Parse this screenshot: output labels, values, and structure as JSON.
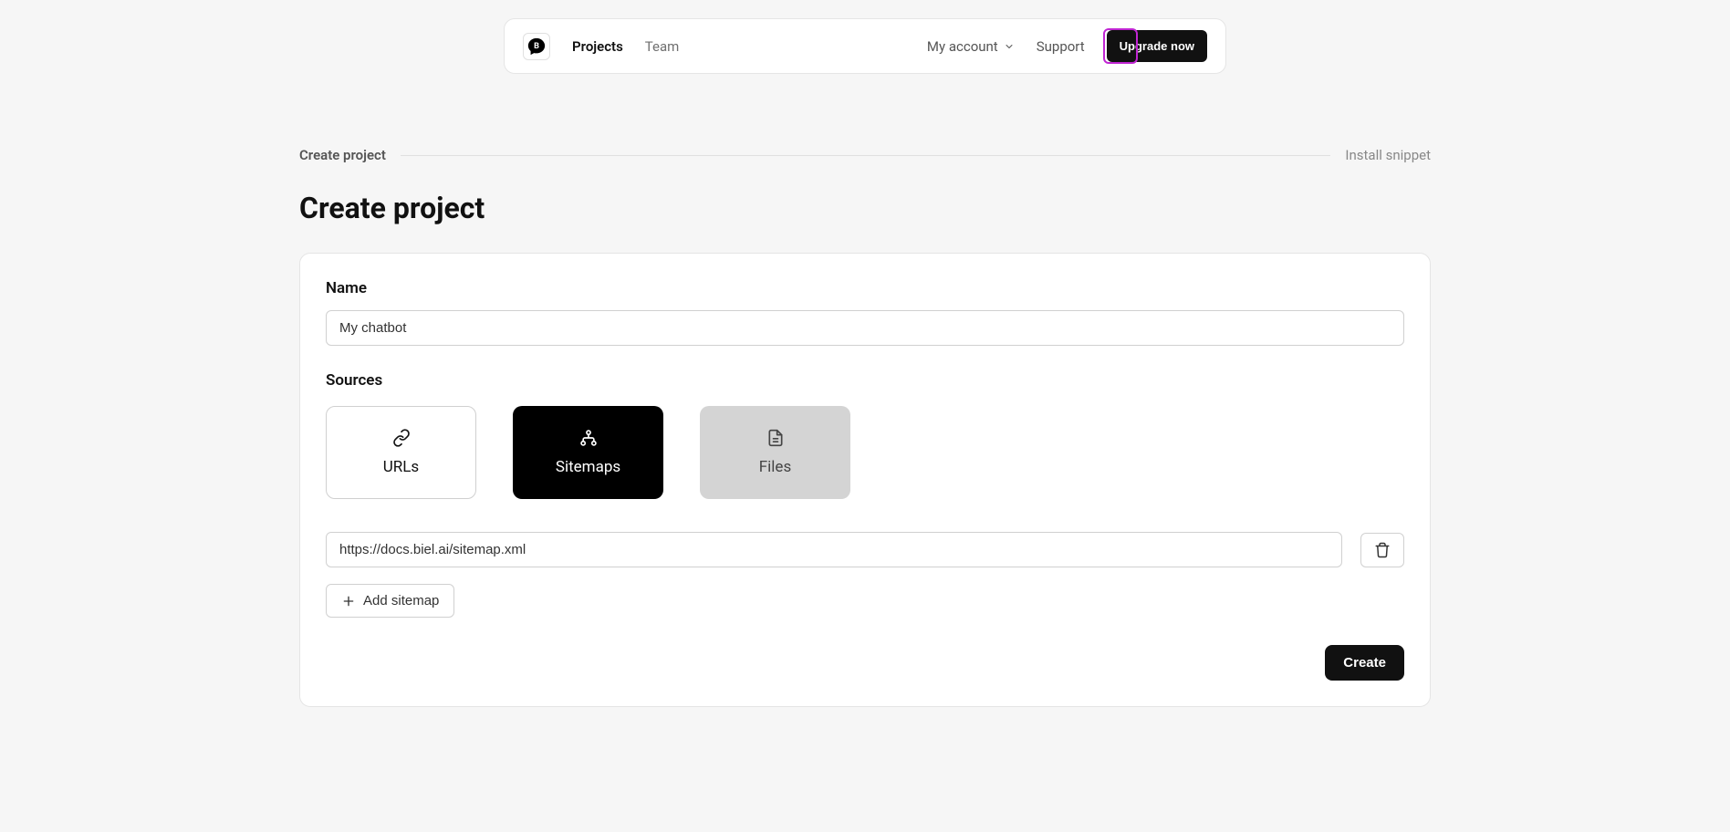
{
  "header": {
    "nav": {
      "projects": "Projects",
      "team": "Team"
    },
    "account": "My account",
    "support": "Support",
    "upgrade": "Upgrade now"
  },
  "breadcrumb": {
    "left": "Create project",
    "right": "Install snippet"
  },
  "page_title": "Create project",
  "form": {
    "name_label": "Name",
    "name_value": "My chatbot",
    "sources_label": "Sources",
    "tabs": {
      "urls": "URLs",
      "sitemaps": "Sitemaps",
      "files": "Files"
    },
    "sitemap_value": "https://docs.biel.ai/sitemap.xml",
    "add_sitemap": "Add sitemap",
    "create_button": "Create"
  }
}
